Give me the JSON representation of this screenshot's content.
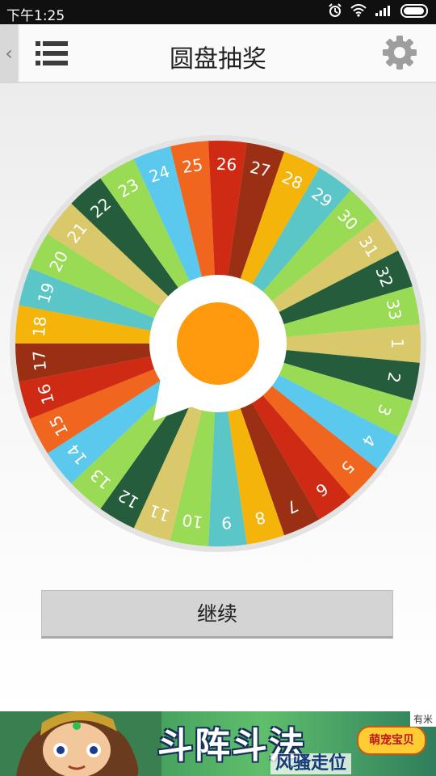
{
  "status_bar": {
    "time": "下午1:25"
  },
  "app_bar": {
    "back_glyph": "‹",
    "title": "圆盘抽奖",
    "menu_icon": "menu-icon",
    "settings_icon": "gear-icon"
  },
  "wheel": {
    "segments": [
      {
        "label": "1",
        "color": "#D9C96A"
      },
      {
        "label": "2",
        "color": "#255D3C"
      },
      {
        "label": "3",
        "color": "#9ADB55"
      },
      {
        "label": "4",
        "color": "#5BC8EE"
      },
      {
        "label": "5",
        "color": "#F0661E"
      },
      {
        "label": "6",
        "color": "#CF2A14"
      },
      {
        "label": "7",
        "color": "#9B2F14"
      },
      {
        "label": "8",
        "color": "#F5B40A"
      },
      {
        "label": "9",
        "color": "#5BC6C8"
      },
      {
        "label": "10",
        "color": "#9ADB55"
      },
      {
        "label": "11",
        "color": "#D9C96A"
      },
      {
        "label": "12",
        "color": "#255D3C"
      },
      {
        "label": "13",
        "color": "#9ADB55"
      },
      {
        "label": "14",
        "color": "#5BC8EE"
      },
      {
        "label": "15",
        "color": "#F0661E"
      },
      {
        "label": "16",
        "color": "#CF2A14"
      },
      {
        "label": "17",
        "color": "#9B2F14"
      },
      {
        "label": "18",
        "color": "#F5B40A"
      },
      {
        "label": "19",
        "color": "#5BC6C8"
      },
      {
        "label": "20",
        "color": "#9ADB55"
      },
      {
        "label": "21",
        "color": "#D9C96A"
      },
      {
        "label": "22",
        "color": "#255D3C"
      },
      {
        "label": "23",
        "color": "#9ADB55"
      },
      {
        "label": "24",
        "color": "#5BC8EE"
      },
      {
        "label": "25",
        "color": "#F0661E"
      },
      {
        "label": "26",
        "color": "#CF2A14"
      },
      {
        "label": "27",
        "color": "#9B2F14"
      },
      {
        "label": "28",
        "color": "#F5B40A"
      },
      {
        "label": "29",
        "color": "#5BC6C8"
      },
      {
        "label": "30",
        "color": "#9ADB55"
      },
      {
        "label": "31",
        "color": "#D9C96A"
      },
      {
        "label": "32",
        "color": "#255D3C"
      },
      {
        "label": "33",
        "color": "#9ADB55"
      }
    ],
    "first_segment_angle_deg": 0,
    "pointer_direction_deg": 130,
    "hub_color": "#FF9A0E"
  },
  "actions": {
    "continue_label": "继续"
  },
  "ad": {
    "headline": "斗阵斗法",
    "sub": "风骚走位",
    "game_name": "萌宠宝贝",
    "badge": "有米"
  }
}
